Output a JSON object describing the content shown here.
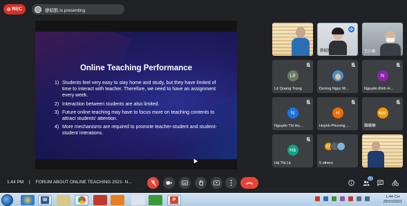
{
  "top_bar": {
    "rec_label": "REC",
    "presenting_text": "廖紹凱 is presenting"
  },
  "slide": {
    "title": "Online Teaching Performance",
    "items": [
      {
        "num": "1)",
        "text": "Students feel very easy to stay home and study, but they have limited of time to interact with teacher. Therefore, we need to have an assignment every week."
      },
      {
        "num": "2)",
        "text": "Interaction between students are also limited."
      },
      {
        "num": "3)",
        "text": "Future online teaching may have to focus more on teaching contents to attract students’ attention."
      },
      {
        "num": "4)",
        "text": "More mechanisms are required to promote teacher-student and student-student interations."
      }
    ]
  },
  "participants": [
    {
      "name": "",
      "kind": "slide-thumb"
    },
    {
      "name": "廖紹凱",
      "kind": "video-active"
    },
    {
      "name": "王仁彬",
      "kind": "video"
    },
    {
      "name": "Lê Quang Trọng",
      "initial": "Lê",
      "color": "#6b7b5e"
    },
    {
      "name": "Dương Ngọc M...",
      "kind": "photo"
    },
    {
      "name": "Nguyễn Đình H...",
      "initial": "N",
      "color": "#8e24aa"
    },
    {
      "name": "Nguyễn Thị Hu...",
      "initial": "N",
      "color": "#1a73e8"
    },
    {
      "name": "Huỳnh Phương ...",
      "initial": "H",
      "color": "#ef6c00"
    },
    {
      "name": "韓曉琳",
      "initial": "曉琳",
      "color": "#f29900"
    },
    {
      "name": "Hà Thị Là",
      "initial": "Hà",
      "color": "#12a085"
    },
    {
      "name": "5 others",
      "kind": "others"
    },
    {
      "name": "",
      "kind": "video2"
    }
  ],
  "others_avatar_label": "韓曉",
  "meeting": {
    "time": "1:44 PM",
    "separator": "|",
    "title": "FORUM ABOUT ONLINE TEACHING 2021- N..."
  },
  "controls": {
    "participant_count": "17"
  },
  "taskbar": {
    "word_label": "W",
    "powerpoint_label": "P",
    "clock_time": "1:44 CH",
    "clock_date": "29/10/2021"
  },
  "colors": {
    "accent": "#8ab4f8",
    "red": "#ea4335",
    "bg": "#202124"
  }
}
